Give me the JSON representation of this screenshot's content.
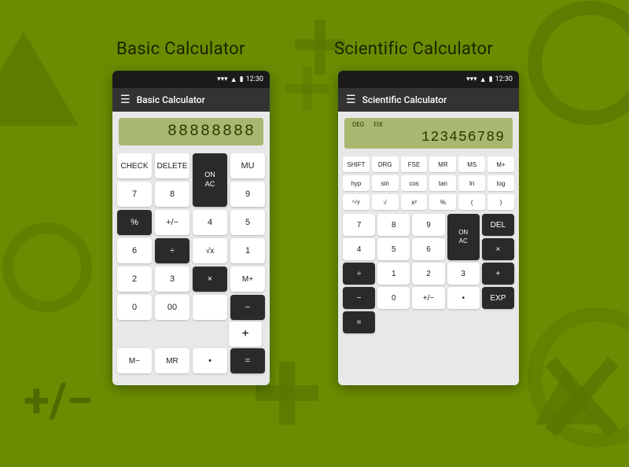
{
  "background": {
    "color": "#6b8c00"
  },
  "basic_calculator": {
    "title": "Basic Calculator",
    "app_bar_title": "Basic Calculator",
    "status_time": "12:30",
    "display_value": "88888888",
    "buttons_row1": [
      {
        "label": "CHECK",
        "type": "white",
        "span": 1
      },
      {
        "label": "DELETE",
        "type": "white",
        "span": 1
      },
      {
        "label": "ON\nAC",
        "type": "dark",
        "span": 1,
        "rowspan": 2
      }
    ],
    "buttons_row2": [
      {
        "label": "MU",
        "type": "white"
      },
      {
        "label": "7",
        "type": "white"
      },
      {
        "label": "8",
        "type": "white"
      },
      {
        "label": "9",
        "type": "white"
      },
      {
        "label": "%",
        "type": "dark"
      }
    ],
    "buttons_row3": [
      {
        "label": "+/−",
        "type": "white"
      },
      {
        "label": "4",
        "type": "white"
      },
      {
        "label": "5",
        "type": "white"
      },
      {
        "label": "6",
        "type": "white"
      },
      {
        "label": "÷",
        "type": "dark"
      }
    ],
    "buttons_row4": [
      {
        "label": "√x",
        "type": "white"
      },
      {
        "label": "1",
        "type": "white"
      },
      {
        "label": "2",
        "type": "white"
      },
      {
        "label": "3",
        "type": "white"
      },
      {
        "label": "×",
        "type": "dark"
      }
    ],
    "buttons_row5": [
      {
        "label": "M+",
        "type": "white"
      },
      {
        "label": "0",
        "type": "white"
      },
      {
        "label": "00",
        "type": "white"
      },
      {
        "label": "",
        "type": "white"
      },
      {
        "label": "−",
        "type": "dark"
      }
    ],
    "buttons_row6": [
      {
        "label": "M−",
        "type": "white"
      },
      {
        "label": "MR",
        "type": "white"
      },
      {
        "label": "•",
        "type": "white"
      },
      {
        "label": "=",
        "type": "dark"
      }
    ]
  },
  "scientific_calculator": {
    "title": "Scientific Calculator",
    "app_bar_title": "Scientific Calculator",
    "status_time": "12:30",
    "display_mode1": "DEG",
    "display_mode2": "FIX",
    "display_value": "123456789",
    "top_row1": [
      "SHIFT",
      "DRG",
      "FSE",
      "MR",
      "MS",
      "M+"
    ],
    "top_row2": [
      "hyp",
      "sin",
      "cos",
      "tan",
      "ln",
      "log"
    ],
    "top_row3": [
      "ˣ√y",
      "√",
      "x²",
      "%",
      "(",
      ")"
    ],
    "main_buttons": [
      {
        "label": "7",
        "type": "white"
      },
      {
        "label": "8",
        "type": "white"
      },
      {
        "label": "9",
        "type": "white"
      },
      {
        "label": "ON\nAC",
        "type": "dark",
        "rowspan": 2
      },
      {
        "label": "DEL",
        "type": "dark"
      },
      {
        "label": "4",
        "type": "white"
      },
      {
        "label": "5",
        "type": "white"
      },
      {
        "label": "6",
        "type": "white"
      },
      {
        "label": "×",
        "type": "dark"
      },
      {
        "label": "÷",
        "type": "dark"
      },
      {
        "label": "1",
        "type": "white"
      },
      {
        "label": "2",
        "type": "white"
      },
      {
        "label": "3",
        "type": "white"
      },
      {
        "label": "+",
        "type": "dark"
      },
      {
        "label": "−",
        "type": "dark"
      },
      {
        "label": "0",
        "type": "white"
      },
      {
        "label": "+/−",
        "type": "white"
      },
      {
        "label": "•",
        "type": "white"
      },
      {
        "label": "EXP",
        "type": "dark"
      },
      {
        "label": "=",
        "type": "dark"
      }
    ]
  }
}
